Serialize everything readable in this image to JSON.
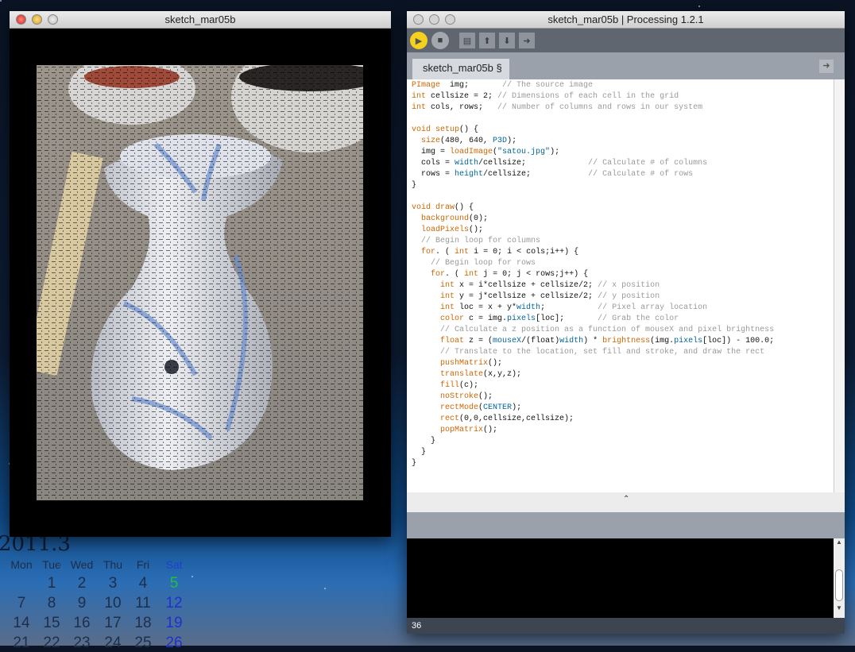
{
  "desktop": {
    "calendar": {
      "title": "2011.3",
      "weekdays": [
        "Mon",
        "Tue",
        "Wed",
        "Thu",
        "Fri",
        "Sat"
      ],
      "rows": [
        [
          "",
          "1",
          "2",
          "3",
          "4",
          "5"
        ],
        [
          "7",
          "8",
          "9",
          "10",
          "11",
          "12"
        ],
        [
          "14",
          "15",
          "16",
          "17",
          "18",
          "19"
        ],
        [
          "21",
          "22",
          "23",
          "24",
          "25",
          "26"
        ]
      ]
    }
  },
  "sketch_window": {
    "title": "sketch_mar05b"
  },
  "ide": {
    "title": "sketch_mar05b | Processing 1.2.1",
    "toolbar": [
      "run",
      "stop",
      "new",
      "open",
      "save",
      "export"
    ],
    "tab": "sketch_mar05b §",
    "status_line": "36",
    "code": [
      [
        [
          "k",
          "PImage"
        ],
        [
          "",
          "  img;       "
        ],
        [
          "c",
          "// The source image"
        ]
      ],
      [
        [
          "k",
          "int"
        ],
        [
          "",
          " cellsize = 2; "
        ],
        [
          "c",
          "// Dimensions of each cell in the grid"
        ]
      ],
      [
        [
          "k",
          "int"
        ],
        [
          "",
          " cols, rows;   "
        ],
        [
          "c",
          "// Number of columns and rows in our system"
        ]
      ],
      [],
      [
        [
          "k",
          "void"
        ],
        [
          "",
          " "
        ],
        [
          "k",
          "setup"
        ],
        [
          "",
          "() {"
        ]
      ],
      [
        [
          "",
          "  "
        ],
        [
          "k",
          "size"
        ],
        [
          "",
          "(480, 640, "
        ],
        [
          "b",
          "P3D"
        ],
        [
          "",
          ");"
        ]
      ],
      [
        [
          "",
          "  img = "
        ],
        [
          "k",
          "loadImage"
        ],
        [
          "",
          "("
        ],
        [
          "b",
          "\"satou.jpg\""
        ],
        [
          "",
          ");"
        ]
      ],
      [
        [
          "",
          "  cols = "
        ],
        [
          "b",
          "width"
        ],
        [
          "",
          "/cellsize;             "
        ],
        [
          "c",
          "// Calculate # of columns"
        ]
      ],
      [
        [
          "",
          "  rows = "
        ],
        [
          "b",
          "height"
        ],
        [
          "",
          "/cellsize;            "
        ],
        [
          "c",
          "// Calculate # of rows"
        ]
      ],
      [
        [
          "",
          "}"
        ]
      ],
      [],
      [
        [
          "k",
          "void"
        ],
        [
          "",
          " "
        ],
        [
          "k",
          "draw"
        ],
        [
          "",
          "() {"
        ]
      ],
      [
        [
          "",
          "  "
        ],
        [
          "k",
          "background"
        ],
        [
          "",
          "(0);"
        ]
      ],
      [
        [
          "",
          "  "
        ],
        [
          "k",
          "loadPixels"
        ],
        [
          "",
          "();"
        ]
      ],
      [
        [
          "",
          "  "
        ],
        [
          "c",
          "// Begin loop for columns"
        ]
      ],
      [
        [
          "",
          "  "
        ],
        [
          "k",
          "for"
        ],
        [
          "",
          ". ( "
        ],
        [
          "k",
          "int"
        ],
        [
          "",
          " i = 0; i < cols;i++) {"
        ]
      ],
      [
        [
          "",
          "    "
        ],
        [
          "c",
          "// Begin loop for rows"
        ]
      ],
      [
        [
          "",
          "    "
        ],
        [
          "k",
          "for"
        ],
        [
          "",
          ". ( "
        ],
        [
          "k",
          "int"
        ],
        [
          "",
          " j = 0; j < rows;j++) {"
        ]
      ],
      [
        [
          "",
          "      "
        ],
        [
          "k",
          "int"
        ],
        [
          "",
          " x = i*cellsize + cellsize/2; "
        ],
        [
          "c",
          "// x position"
        ]
      ],
      [
        [
          "",
          "      "
        ],
        [
          "k",
          "int"
        ],
        [
          "",
          " y = j*cellsize + cellsize/2; "
        ],
        [
          "c",
          "// y position"
        ]
      ],
      [
        [
          "",
          "      "
        ],
        [
          "k",
          "int"
        ],
        [
          "",
          " loc = x + y*"
        ],
        [
          "b",
          "width"
        ],
        [
          "",
          ";           "
        ],
        [
          "c",
          "// Pixel array location"
        ]
      ],
      [
        [
          "",
          "      "
        ],
        [
          "k",
          "color"
        ],
        [
          "",
          " c = img."
        ],
        [
          "b",
          "pixels"
        ],
        [
          "",
          "[loc];       "
        ],
        [
          "c",
          "// Grab the color"
        ]
      ],
      [
        [
          "",
          "      "
        ],
        [
          "c",
          "// Calculate a z position as a function of mouseX and pixel brightness"
        ]
      ],
      [
        [
          "",
          "      "
        ],
        [
          "k",
          "float"
        ],
        [
          "",
          " z = ("
        ],
        [
          "b",
          "mouseX"
        ],
        [
          "",
          "/(float)"
        ],
        [
          "b",
          "width"
        ],
        [
          "",
          ") * "
        ],
        [
          "k",
          "brightness"
        ],
        [
          "",
          "(img."
        ],
        [
          "b",
          "pixels"
        ],
        [
          "",
          "[loc]) - 100.0;"
        ]
      ],
      [
        [
          "",
          "      "
        ],
        [
          "c",
          "// Translate to the location, set fill and stroke, and draw the rect"
        ]
      ],
      [
        [
          "",
          "      "
        ],
        [
          "k",
          "pushMatrix"
        ],
        [
          "",
          "();"
        ]
      ],
      [
        [
          "",
          "      "
        ],
        [
          "k",
          "translate"
        ],
        [
          "",
          "(x,y,z);"
        ]
      ],
      [
        [
          "",
          "      "
        ],
        [
          "k",
          "fill"
        ],
        [
          "",
          "(c);"
        ]
      ],
      [
        [
          "",
          "      "
        ],
        [
          "k",
          "noStroke"
        ],
        [
          "",
          "();"
        ]
      ],
      [
        [
          "",
          "      "
        ],
        [
          "k",
          "rectMode"
        ],
        [
          "",
          "("
        ],
        [
          "b",
          "CENTER"
        ],
        [
          "",
          ");"
        ]
      ],
      [
        [
          "",
          "      "
        ],
        [
          "k",
          "rect"
        ],
        [
          "",
          "(0,0,cellsize,cellsize);"
        ]
      ],
      [
        [
          "",
          "      "
        ],
        [
          "k",
          "popMatrix"
        ],
        [
          "",
          "();"
        ]
      ],
      [
        [
          "",
          "    }"
        ]
      ],
      [
        [
          "",
          "  }"
        ]
      ],
      [
        [
          "",
          "}"
        ]
      ]
    ]
  },
  "colors": {
    "keyword": "#cc6600",
    "builtin": "#006699",
    "comment": "#9a9a9a",
    "run": "#f5d11e"
  }
}
